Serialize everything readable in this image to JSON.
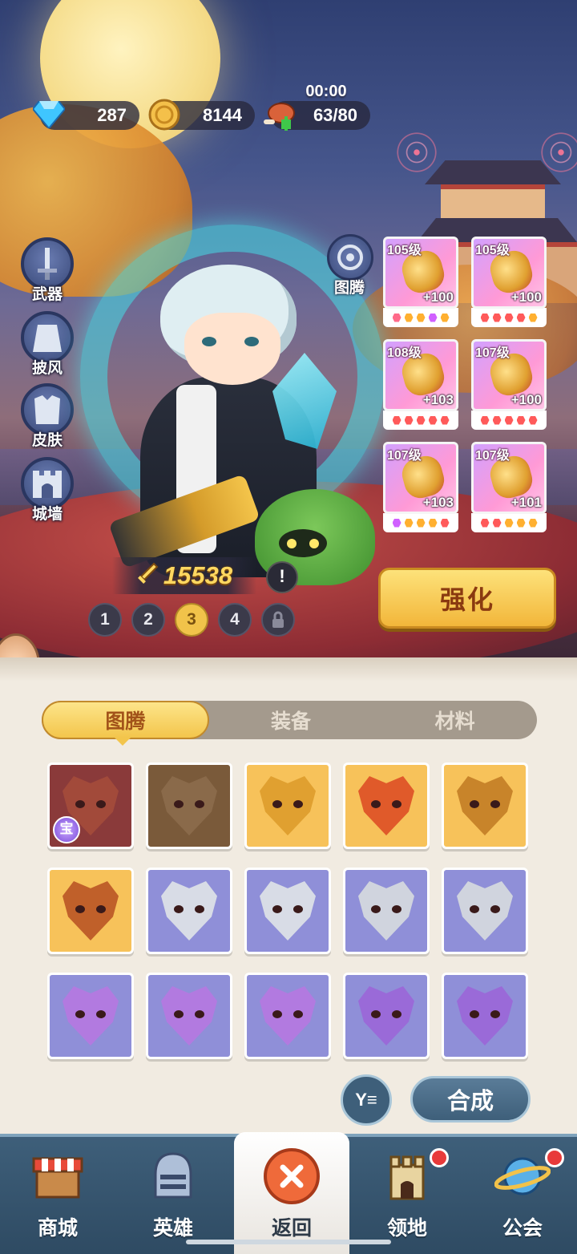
{
  "resources": {
    "gems": "287",
    "gold": "8144",
    "stamina": "63/80",
    "timer": "00:00"
  },
  "side_menu": [
    "武器",
    "披风",
    "皮肤",
    "城墙"
  ],
  "totem_button": "图腾",
  "power": "15538",
  "info_mark": "!",
  "pages": [
    "1",
    "2",
    "3",
    "4"
  ],
  "active_page": 3,
  "equipment": [
    {
      "level": "105级",
      "plus": "+100",
      "stars": [
        "#ff6a8a",
        "#ffb030",
        "#ffb030",
        "#d060ff",
        "#ffb030"
      ]
    },
    {
      "level": "105级",
      "plus": "+100",
      "stars": [
        "#ff5a5a",
        "#ff5a5a",
        "#ff5a5a",
        "#ff5a5a",
        "#ffb030"
      ]
    },
    {
      "level": "108级",
      "plus": "+103",
      "stars": [
        "#ff5a5a",
        "#ff5a5a",
        "#ff5a5a",
        "#ff5a5a",
        "#ff5a5a"
      ]
    },
    {
      "level": "107级",
      "plus": "+100",
      "stars": [
        "#ff5a5a",
        "#ff5a5a",
        "#ff5a5a",
        "#ff5a5a",
        "#ff5a5a"
      ]
    },
    {
      "level": "107级",
      "plus": "+103",
      "stars": [
        "#d060ff",
        "#ffb030",
        "#ffb030",
        "#ffb030",
        "#ff5a5a"
      ]
    },
    {
      "level": "107级",
      "plus": "+101",
      "stars": [
        "#ff5a5a",
        "#ff5a5a",
        "#ffb030",
        "#ffb030",
        "#ffb030"
      ]
    }
  ],
  "strengthen_label": "强化",
  "tabs": [
    "图腾",
    "装备",
    "材料"
  ],
  "totems": [
    {
      "bg": "#8a3a3a",
      "mask": "#a24a3a",
      "badge": "宝"
    },
    {
      "bg": "#7a5a3a",
      "mask": "#8a6a4a"
    },
    {
      "bg": "#f7c25a",
      "mask": "#e0a030"
    },
    {
      "bg": "#f7c25a",
      "mask": "#e05a2a"
    },
    {
      "bg": "#f7c25a",
      "mask": "#c8842a"
    },
    {
      "bg": "#f7c25a",
      "mask": "#c0602a"
    },
    {
      "bg": "#8f8fd8",
      "mask": "#d8dce6"
    },
    {
      "bg": "#8f8fd8",
      "mask": "#d8dce6"
    },
    {
      "bg": "#8f8fd8",
      "mask": "#d0d4de"
    },
    {
      "bg": "#8f8fd8",
      "mask": "#d0d4de"
    },
    {
      "bg": "#8f8fd8",
      "mask": "#b27ae0"
    },
    {
      "bg": "#8f8fd8",
      "mask": "#b27ae0"
    },
    {
      "bg": "#8f8fd8",
      "mask": "#b27ae0"
    },
    {
      "bg": "#8f8fd8",
      "mask": "#9a6ad8"
    },
    {
      "bg": "#8f8fd8",
      "mask": "#9a6ad8"
    }
  ],
  "filter_label": "Y≡",
  "merge_label": "合成",
  "nav": [
    {
      "label": "商城",
      "icon": "shop-icon",
      "dot": false
    },
    {
      "label": "英雄",
      "icon": "helmet-icon",
      "dot": false
    },
    {
      "label": "返回",
      "icon": "close-icon",
      "dot": false
    },
    {
      "label": "领地",
      "icon": "castle-icon",
      "dot": true
    },
    {
      "label": "公会",
      "icon": "planet-icon",
      "dot": true
    }
  ]
}
